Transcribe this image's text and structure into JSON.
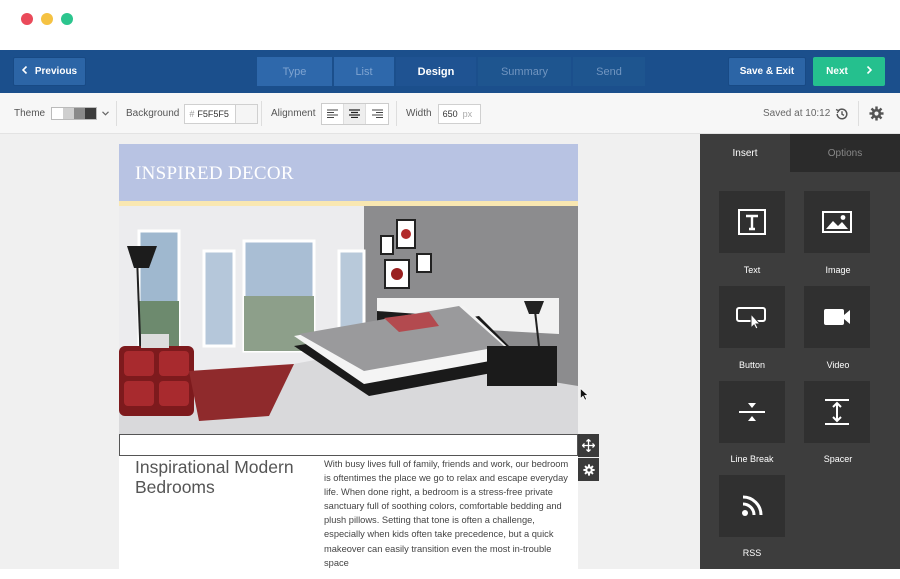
{
  "window": {
    "dots": [
      "#ea4a5a",
      "#f5c242",
      "#2cc58e"
    ]
  },
  "nav": {
    "previous_label": "Previous",
    "steps": [
      {
        "label": "Type",
        "state": "done"
      },
      {
        "label": "List",
        "state": "done"
      },
      {
        "label": "Design",
        "state": "active"
      },
      {
        "label": "Summary",
        "state": "future"
      },
      {
        "label": "Send",
        "state": "future"
      }
    ],
    "save_exit_label": "Save & Exit",
    "next_label": "Next"
  },
  "toolbar": {
    "theme_label": "Theme",
    "background_label": "Background",
    "background_hash": "#",
    "background_value": "F5F5F5",
    "alignment_label": "Alignment",
    "width_label": "Width",
    "width_value": "650",
    "width_unit": "px",
    "saved_text": "Saved at 10:12"
  },
  "email": {
    "header_title": "INSPIRED DECOR",
    "body_title": "Inspirational Modern Bedrooms",
    "body_text": "With busy lives full of family, friends and work, our bedroom is oftentimes the place we go to relax and escape everyday life. When done right, a bedroom is a stress-free private sanctuary full of soothing colors, comfortable bedding and plush pillows. Setting that tone is often a challenge, especially when kids often take precedence, but a quick makeover can easily transition even the most in-trouble space"
  },
  "panel": {
    "tab_insert": "Insert",
    "tab_options": "Options",
    "tiles": [
      {
        "label": "Text",
        "icon": "text-icon"
      },
      {
        "label": "Image",
        "icon": "image-icon"
      },
      {
        "label": "Button",
        "icon": "button-icon"
      },
      {
        "label": "Video",
        "icon": "video-icon"
      },
      {
        "label": "Line Break",
        "icon": "line-break-icon"
      },
      {
        "label": "Spacer",
        "icon": "spacer-icon"
      },
      {
        "label": "RSS",
        "icon": "rss-icon"
      }
    ]
  },
  "colors": {
    "nav_bg": "#1b4f8c",
    "next_green": "#25c08e",
    "header_band": "#b8c3e3",
    "panel_bg": "#3d3d3d"
  }
}
